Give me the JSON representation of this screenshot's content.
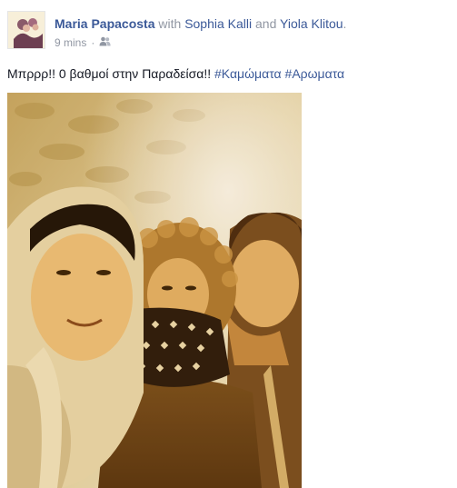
{
  "post": {
    "author": "Maria Papacosta",
    "with_word": "with",
    "tagged_1": "Sophia Kalli",
    "and_word": "and",
    "tagged_2": "Yiola Klitou",
    "period": ".",
    "timestamp": "9 mins",
    "separator": "·",
    "audience_icon": "friends-icon",
    "status_text": "Μπρρρ!! 0 βαθμοί στην Παραδείσα!!",
    "hashtags": [
      "#Καμώματα",
      "#Αρωματα"
    ]
  },
  "colors": {
    "link": "#3b5998",
    "meta": "#9197a3",
    "text": "#141823"
  }
}
